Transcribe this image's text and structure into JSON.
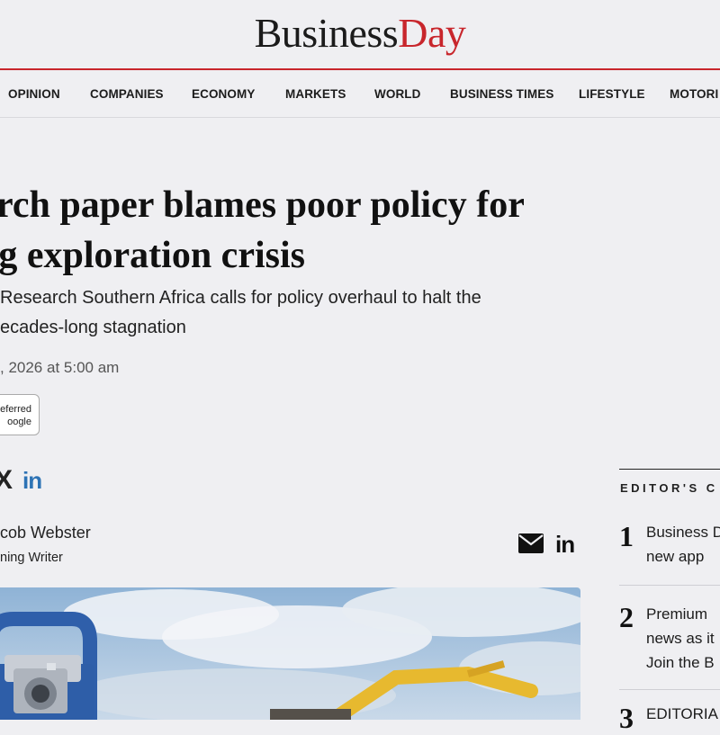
{
  "brand": {
    "part1": "Business",
    "part2": "Day",
    "accent_color": "#c8262c"
  },
  "nav": {
    "items": [
      "OPINION",
      "COMPANIES",
      "ECONOMY",
      "MARKETS",
      "WORLD",
      "BUSINESS TIMES",
      "LIFESTYLE",
      "MOTORI"
    ]
  },
  "article": {
    "headline_line1": "arch paper blames poor policy for",
    "headline_line2": "ng exploration crisis",
    "deck_line1": "Research Southern Africa calls for policy overhaul to halt the",
    "deck_line2": "ecades-long stagnation",
    "date": ", 2026 at 5:00 am",
    "preferred_line1": "eferred",
    "preferred_line2": "oogle",
    "share_x": "X",
    "share_linkedin": "in",
    "author_name": "cob Webster",
    "author_role": "ning Writer",
    "author_linkedin": "in"
  },
  "sidebar": {
    "title": "EDITOR'S C",
    "items": [
      {
        "num": "1",
        "line1": "Business D",
        "line2": "new app",
        "line3": ""
      },
      {
        "num": "2",
        "line1": "Premium",
        "line2": "news as it",
        "line3": "Join the B"
      },
      {
        "num": "3",
        "line1": "EDITORIA",
        "line2": "",
        "line3": ""
      }
    ]
  },
  "icons": {
    "mail": "envelope-icon",
    "linkedin": "linkedin-icon",
    "x": "x-icon"
  }
}
